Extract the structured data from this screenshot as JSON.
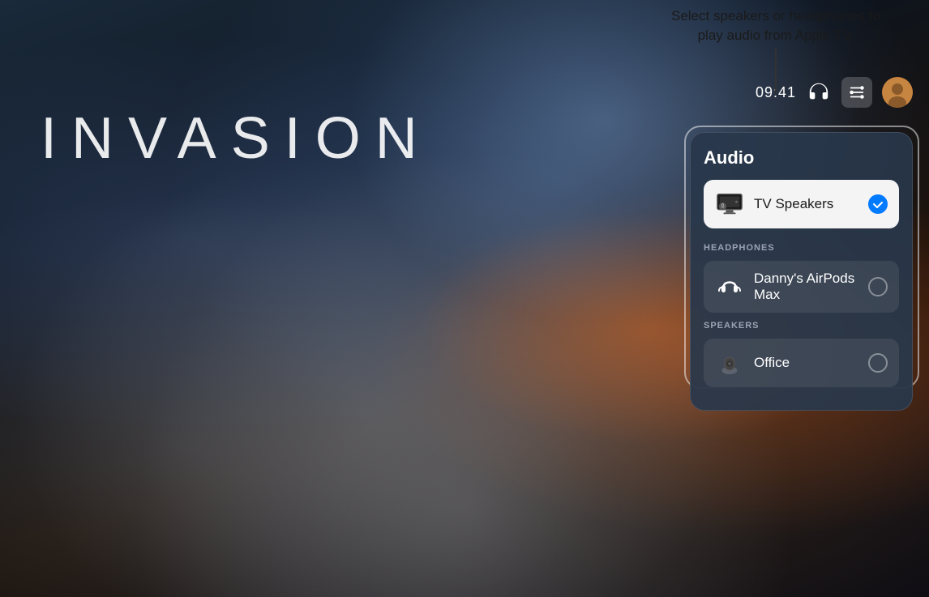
{
  "tooltip": {
    "line1": "Select speakers or headphones to",
    "line2": "play audio from Apple TV."
  },
  "topbar": {
    "time": "09:41"
  },
  "movie": {
    "title": "INVASION"
  },
  "audioPanel": {
    "title": "Audio",
    "tvSpeakersLabel": "TV Speakers",
    "headphonesSection": "HEADPHONES",
    "airpodsLabel": "Danny's AirPods Max",
    "speakersSection": "SPEAKERS",
    "officeLabel": "Office"
  }
}
